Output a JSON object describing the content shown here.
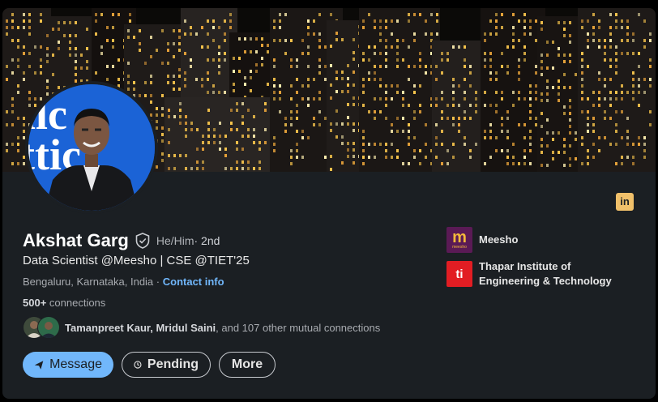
{
  "profile": {
    "name": "Akshat Garg",
    "pronouns": "He/Him",
    "degree": " · 2nd",
    "headline": "Data Scientist @Meesho | CSE @TIET'25",
    "location": "Bengaluru, Karnataka, India",
    "location_sep": " · ",
    "contact_info": "Contact info",
    "connections_count": "500+",
    "connections_label": " connections",
    "avatar_bg_text": "ilc ittic"
  },
  "mutual": {
    "names": "Tamanpreet Kaur, Mridul Saini",
    "rest": ", and 107 other mutual connections"
  },
  "actions": {
    "message": "Message",
    "pending": "Pending",
    "more": "More"
  },
  "orgs": {
    "company": {
      "name": "Meesho",
      "logo_letter": "m",
      "logo_sub": "meesho",
      "color": "#5a1a55"
    },
    "school": {
      "name_line1": "Thapar Institute of",
      "name_line2": "Engineering & Technology",
      "logo_letter": "ti",
      "color": "#e21d23"
    }
  },
  "colors": {
    "card_bg": "#1b1f23",
    "accent": "#71b7fb",
    "linkedin_badge": "#f0c06a"
  },
  "icons": {
    "linkedin": "linkedin-icon",
    "verified": "verified-shield-icon",
    "send": "send-icon",
    "clock": "clock-icon"
  }
}
